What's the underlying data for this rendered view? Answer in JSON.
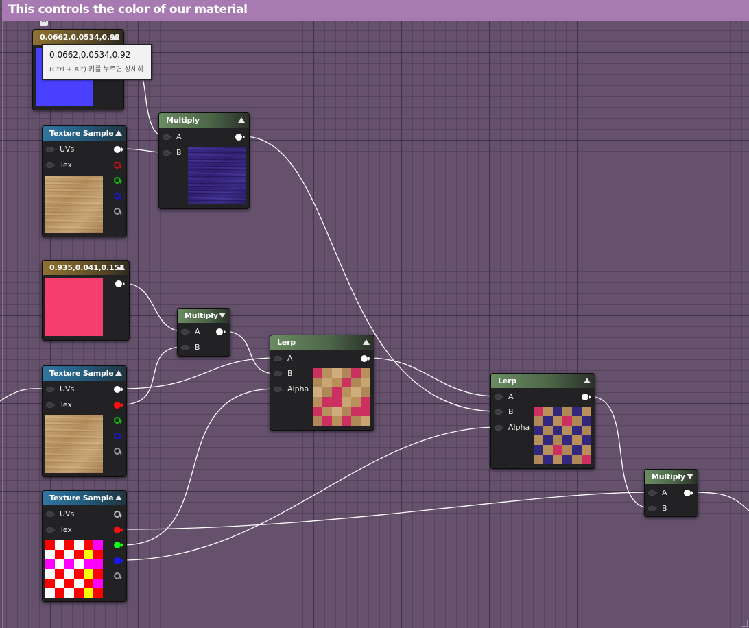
{
  "comment": {
    "title": "This controls the color of our material"
  },
  "tooltip": {
    "value": "0.0662,0.0534,0.92",
    "hint": "(Ctrl + Alt) 키를 누르면 상세히"
  },
  "nodes": {
    "const_blue": {
      "title": "0.0662,0.0534,0.92",
      "color": "#4a40ff"
    },
    "tex1": {
      "title": "Texture Sample",
      "pins": {
        "uvs": "UVs",
        "tex": "Tex"
      }
    },
    "multiply1": {
      "title": "Multiply",
      "pins": {
        "a": "A",
        "b": "B"
      }
    },
    "const_pink": {
      "title": "0.935,0.041,0.153",
      "color": "#f53d6e"
    },
    "multiply2": {
      "title": "Multiply",
      "pins": {
        "a": "A",
        "b": "B"
      }
    },
    "tex2": {
      "title": "Texture Sample",
      "pins": {
        "uvs": "UVs",
        "tex": "Tex"
      }
    },
    "lerp1": {
      "title": "Lerp",
      "pins": {
        "a": "A",
        "b": "B",
        "alpha": "Alpha"
      }
    },
    "tex3": {
      "title": "Texture Sample",
      "pins": {
        "uvs": "UVs",
        "tex": "Tex"
      }
    },
    "lerp2": {
      "title": "Lerp",
      "pins": {
        "a": "A",
        "b": "B",
        "alpha": "Alpha"
      }
    },
    "multiply3": {
      "title": "Multiply",
      "pins": {
        "a": "A",
        "b": "B"
      }
    }
  },
  "colors": {
    "pin_red": "#ff1010",
    "pin_green": "#10ff10",
    "pin_blue": "#1818ff",
    "wire": "#ffffff",
    "mask_red": "#ff0000",
    "mask_magenta": "#ff00ff",
    "mask_yellow": "#ffff00",
    "mask_white": "#ffffff"
  }
}
